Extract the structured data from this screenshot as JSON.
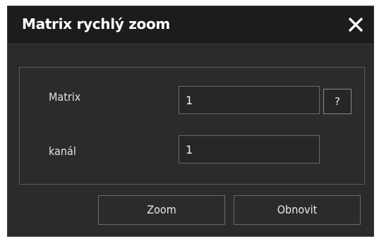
{
  "dialog": {
    "title": "Matrix rychlý zoom",
    "close_icon": "close-icon",
    "fields": {
      "matrix_label": "Matrix",
      "matrix_value": "1",
      "help_label": "?",
      "channel_label": "kanál",
      "channel_value": "1"
    },
    "buttons": {
      "zoom_label": "Zoom",
      "refresh_label": "Obnovit"
    }
  },
  "colors": {
    "title_bar": "#1c1c1c",
    "dialog_bg": "#2b2b2b",
    "text": "#e2e2e2",
    "border": "#6a6a6a"
  }
}
